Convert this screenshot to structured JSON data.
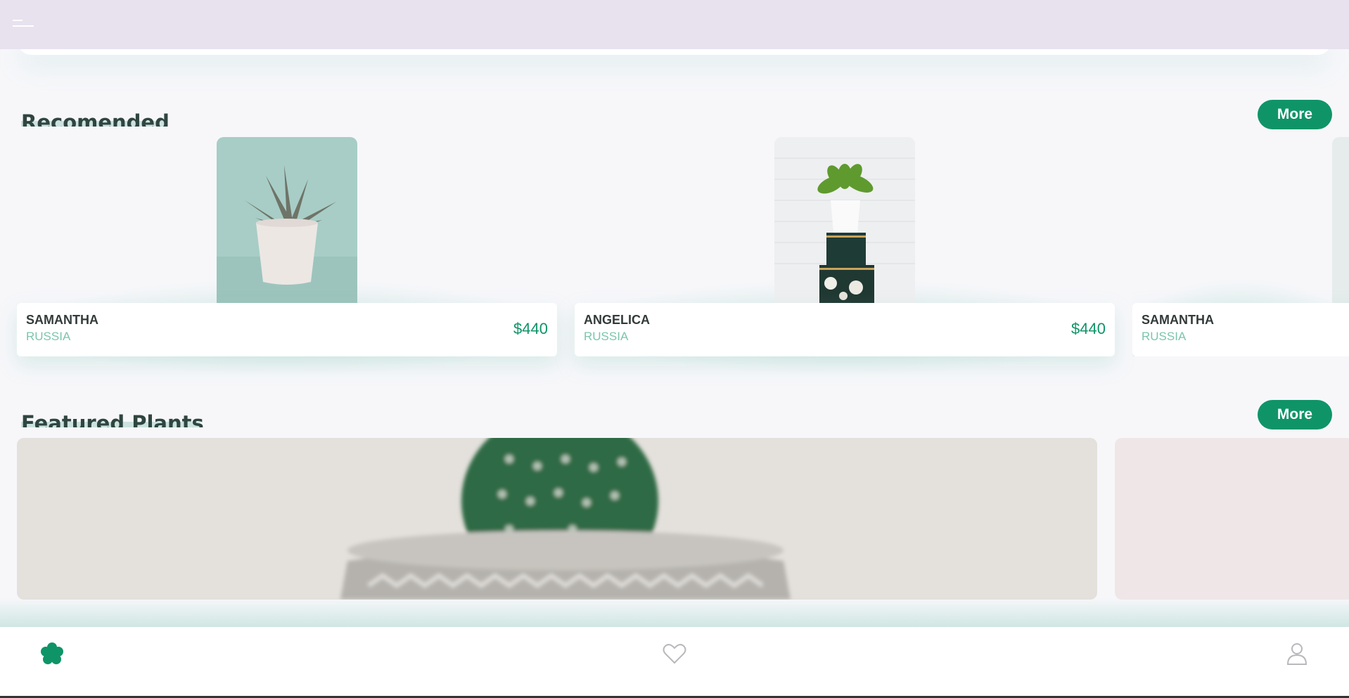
{
  "colors": {
    "accent": "#0f9468",
    "topbar": "#e8e2ef",
    "country_text": "#7bc5ac"
  },
  "header": {
    "menu_icon": "hamburger-menu-icon"
  },
  "recommended": {
    "title": "Recomended",
    "more_label": "More",
    "items": [
      {
        "name": "SAMANTHA",
        "country": "RUSSIA",
        "price": "$440"
      },
      {
        "name": "ANGELICA",
        "country": "RUSSIA",
        "price": "$440"
      },
      {
        "name": "SAMANTHA",
        "country": "RUSSIA",
        "price": ""
      }
    ]
  },
  "featured": {
    "title": "Featured Plants",
    "more_label": "More"
  },
  "bottom_nav": {
    "items": [
      {
        "icon": "flower-icon",
        "active": true
      },
      {
        "icon": "heart-icon",
        "active": false
      },
      {
        "icon": "user-icon",
        "active": false
      }
    ]
  }
}
